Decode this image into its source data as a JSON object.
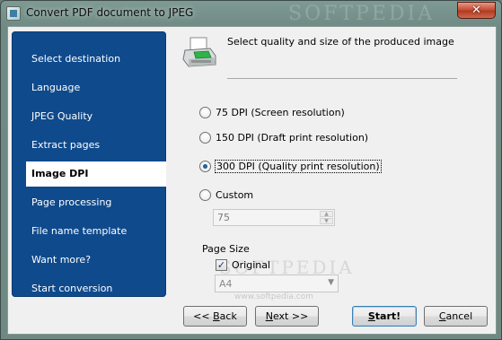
{
  "window": {
    "title": "Convert PDF document to JPEG",
    "close_glyph": "✕",
    "watermark": "SOFTPEDIA"
  },
  "sidebar": {
    "items": [
      {
        "label": "Select destination",
        "active": false
      },
      {
        "label": "Language",
        "active": false
      },
      {
        "label": "JPEG Quality",
        "active": false
      },
      {
        "label": "Extract pages",
        "active": false
      },
      {
        "label": "Image DPI",
        "active": true
      },
      {
        "label": "Page processing",
        "active": false
      },
      {
        "label": "File name template",
        "active": false
      },
      {
        "label": "Want more?",
        "active": false
      },
      {
        "label": "Start conversion",
        "active": false
      }
    ]
  },
  "header": {
    "icon": "printer-icon",
    "text": "Select quality and size of the produced image"
  },
  "dpi_options": [
    {
      "label": "75 DPI (Screen resolution)",
      "checked": false
    },
    {
      "label": "150 DPI (Draft print resolution)",
      "checked": false
    },
    {
      "label": "300 DPI (Quality print resolution)",
      "checked": true
    },
    {
      "label": "Custom",
      "checked": false
    }
  ],
  "custom_dpi": {
    "value": "75"
  },
  "page_size": {
    "label": "Page Size",
    "original_label": "Original",
    "original_checked": true,
    "select_value": "A4",
    "watermark_text": "SOFTPEDIA",
    "watermark_url": "www.softpedia.com"
  },
  "buttons": {
    "back": {
      "prefix": "<< ",
      "key": "B",
      "rest": "ack"
    },
    "next": {
      "key": "N",
      "rest": "ext >>"
    },
    "start": {
      "key": "S",
      "rest": "tart!"
    },
    "cancel": {
      "key": "C",
      "rest": "ancel"
    }
  },
  "colors": {
    "sidebar_bg": "#0f4a8c",
    "active_item_bg": "#ffffff",
    "close_button": "#c7503a"
  }
}
